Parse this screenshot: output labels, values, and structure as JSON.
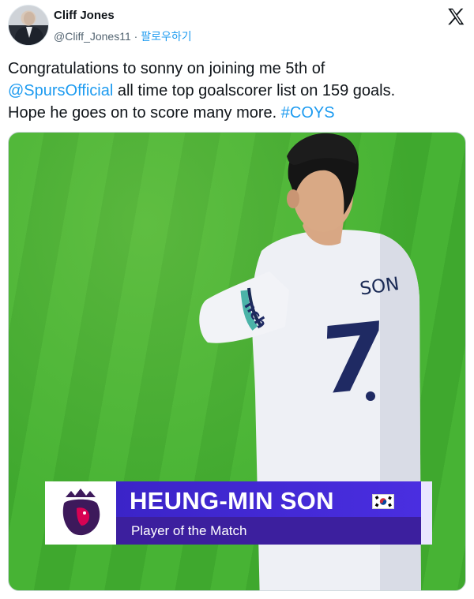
{
  "author": {
    "display_name": "Cliff Jones",
    "handle": "@Cliff_Jones11",
    "separator": " · ",
    "follow_label": "팔로우하기"
  },
  "tweet": {
    "line1": "Congratulations to sonny on joining me  5th of",
    "mention": "@SpursOfficial",
    "line2_rest": " all time top goalscorer list on 159 goals.",
    "line3_text": "Hope he goes on to score many more. ",
    "hashtag": "#COYS"
  },
  "media": {
    "shirt_name": "SON",
    "shirt_number": "7",
    "sleeve_sponsor": "nch",
    "graphic": {
      "player_name": "HEUNG-MIN SON",
      "award": "Player of the Match"
    }
  },
  "colors": {
    "link": "#1d9bf0",
    "graphic_blue": "#4a2ee0",
    "graphic_purple": "#3c1f9e",
    "pitch": "#45ae33"
  },
  "icons": [
    "x-logo-icon",
    "premier-league-lion-icon",
    "south-korea-flag-icon"
  ]
}
